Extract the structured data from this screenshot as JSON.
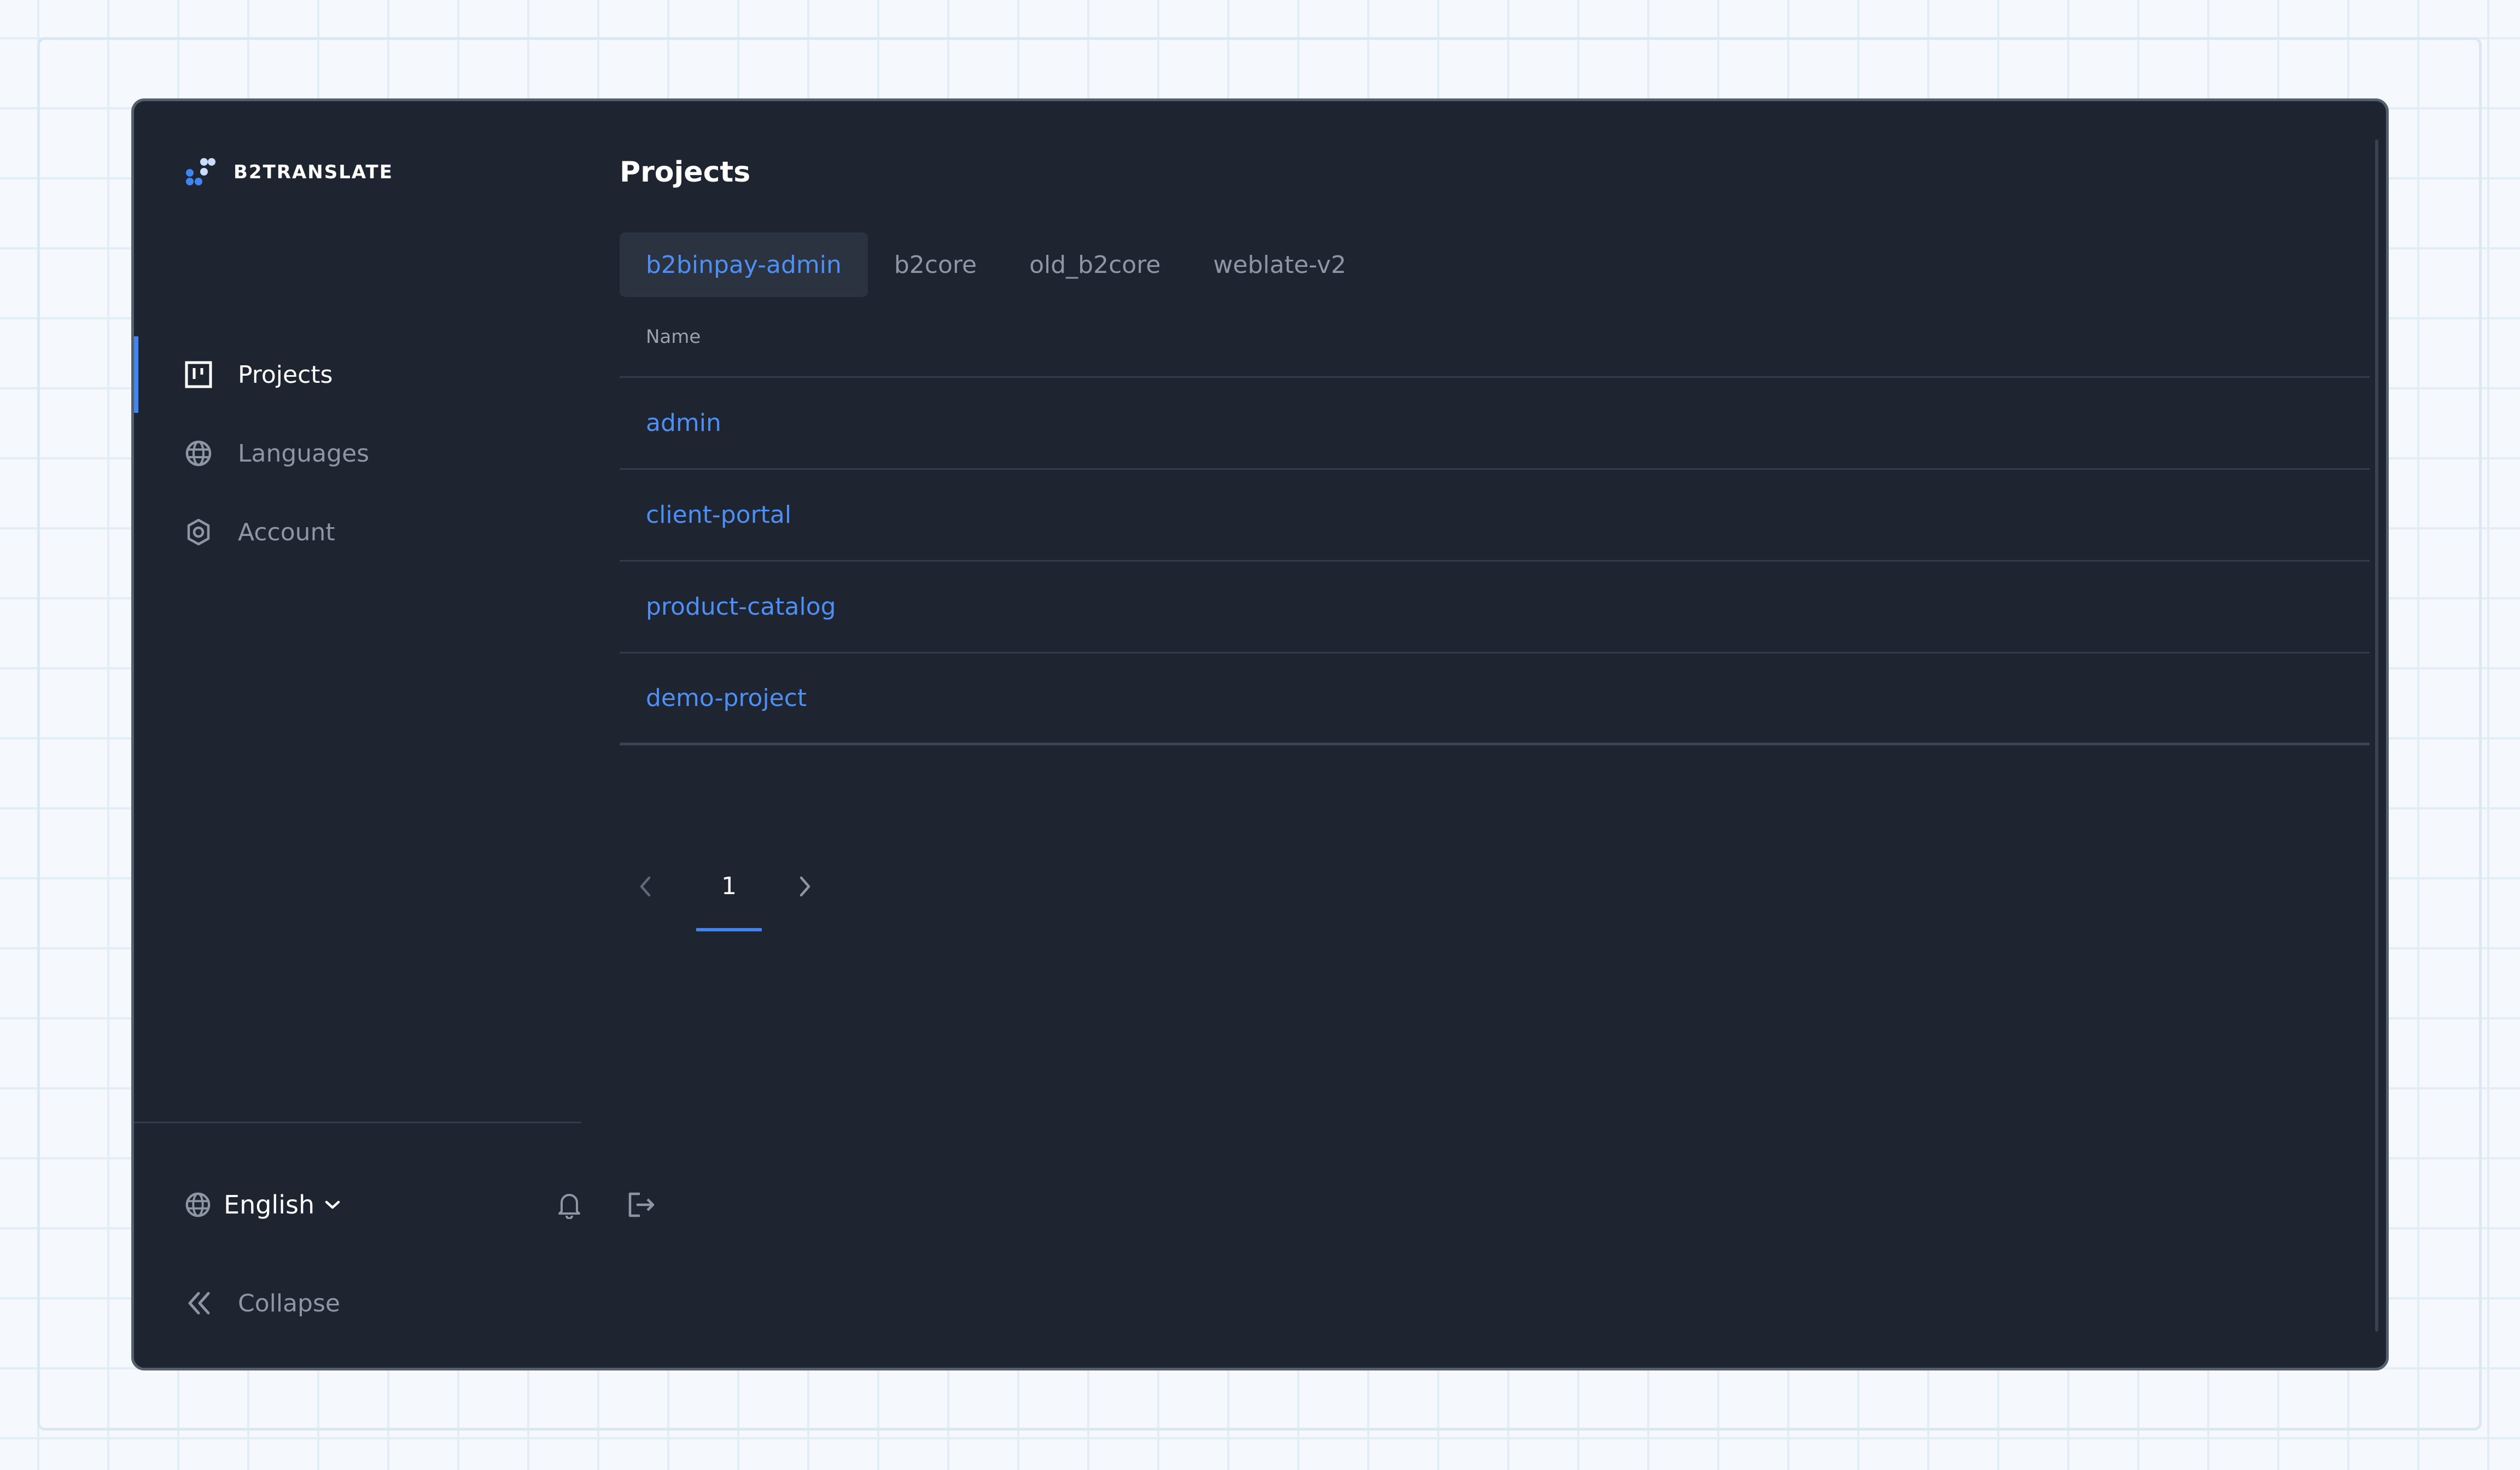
{
  "brand": {
    "name": "B2TRANSLATE",
    "logo_icon": "logo-dots-icon",
    "colors": {
      "primary": "#3f86f3",
      "light": "#c8dcfb"
    }
  },
  "sidebar": {
    "items": [
      {
        "label": "Projects",
        "icon": "board-icon",
        "active": true
      },
      {
        "label": "Languages",
        "icon": "globe-icon",
        "active": false
      },
      {
        "label": "Account",
        "icon": "gear-icon",
        "active": false
      }
    ],
    "language": {
      "label": "English",
      "icon": "globe-icon"
    },
    "notifications_icon": "bell-icon",
    "logout_icon": "logout-icon",
    "collapse_label": "Collapse",
    "collapse_icon": "double-chevron-left-icon"
  },
  "main": {
    "title": "Projects",
    "tabs": [
      {
        "label": "b2binpay-admin",
        "active": true
      },
      {
        "label": "b2core",
        "active": false
      },
      {
        "label": "old_b2core",
        "active": false
      },
      {
        "label": "weblate-v2",
        "active": false
      }
    ],
    "table": {
      "column_name": "Name",
      "rows": [
        "admin",
        "client-portal",
        "product-catalog",
        "demo-project"
      ]
    },
    "pagination": {
      "current_page": "1"
    }
  },
  "theme": {
    "background": "#1e2430",
    "accent": "#4d8ff4",
    "muted_text": "#8d96a3",
    "divider": "#343c49"
  }
}
